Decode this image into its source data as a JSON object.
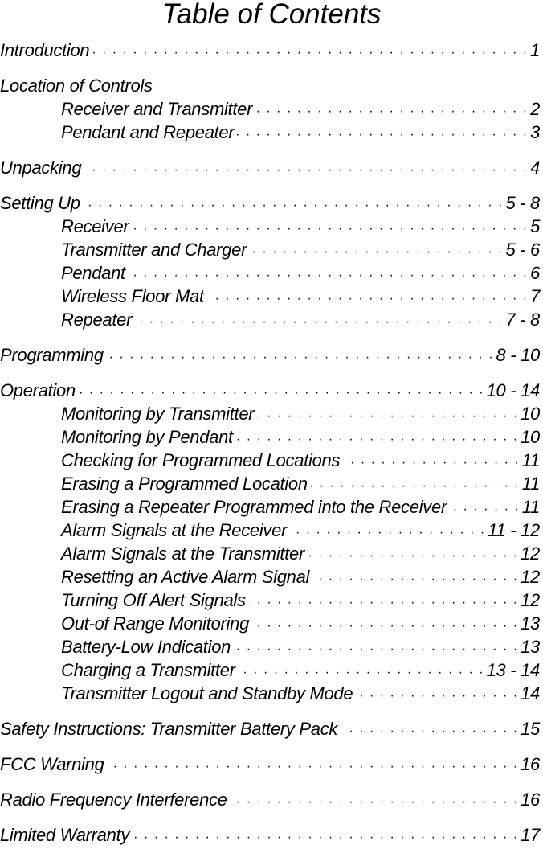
{
  "title": "Table of Contents",
  "entries": [
    {
      "label": "Introduction",
      "page": "1",
      "level": 0,
      "gap": false
    },
    {
      "label": "Location of Controls",
      "page": "",
      "level": 0,
      "gap": true
    },
    {
      "label": "Receiver and Transmitter",
      "page": "2",
      "level": 1,
      "gap": false
    },
    {
      "label": "Pendant and Repeater",
      "page": "3",
      "level": 1,
      "gap": false
    },
    {
      "label": "Unpacking",
      "page": "4",
      "level": 0,
      "gap": true
    },
    {
      "label": "Setting Up",
      "page": "5 - 8",
      "level": 0,
      "gap": true
    },
    {
      "label": "Receiver",
      "page": "5",
      "level": 1,
      "gap": false
    },
    {
      "label": "Transmitter and Charger",
      "page": "5 - 6",
      "level": 1,
      "gap": false
    },
    {
      "label": "Pendant",
      "page": "6",
      "level": 1,
      "gap": false
    },
    {
      "label": "Wireless Floor Mat",
      "page": "7",
      "level": 1,
      "gap": false
    },
    {
      "label": "Repeater",
      "page": "7 - 8",
      "level": 1,
      "gap": false
    },
    {
      "label": "Programming",
      "page": "8 - 10",
      "level": 0,
      "gap": true
    },
    {
      "label": "Operation",
      "page": "10 - 14",
      "level": 0,
      "gap": true
    },
    {
      "label": "Monitoring by Transmitter",
      "page": "10",
      "level": 1,
      "gap": false
    },
    {
      "label": "Monitoring by Pendant",
      "page": "10",
      "level": 1,
      "gap": false
    },
    {
      "label": "Checking for Programmed Locations",
      "page": "11",
      "level": 1,
      "gap": false
    },
    {
      "label": "Erasing a Programmed Location",
      "page": "11",
      "level": 1,
      "gap": false
    },
    {
      "label": "Erasing a Repeater Programmed into the Receiver",
      "page": "11",
      "level": 1,
      "gap": false
    },
    {
      "label": "Alarm Signals at the Receiver",
      "page": "11 - 12",
      "level": 1,
      "gap": false
    },
    {
      "label": "Alarm Signals at the Transmitter",
      "page": "12",
      "level": 1,
      "gap": false
    },
    {
      "label": "Resetting an Active Alarm Signal",
      "page": "12",
      "level": 1,
      "gap": false
    },
    {
      "label": "Turning Off Alert Signals",
      "page": "12",
      "level": 1,
      "gap": false
    },
    {
      "label": "Out-of Range Monitoring",
      "page": "13",
      "level": 1,
      "gap": false
    },
    {
      "label": "Battery-Low Indication",
      "page": "13",
      "level": 1,
      "gap": false
    },
    {
      "label": "Charging a Transmitter",
      "page": "13 - 14",
      "level": 1,
      "gap": false
    },
    {
      "label": "Transmitter Logout and Standby Mode",
      "page": "14",
      "level": 1,
      "gap": false
    },
    {
      "label": "Safety Instructions: Transmitter Battery Pack",
      "page": "15",
      "level": 0,
      "gap": true
    },
    {
      "label": "FCC Warning",
      "page": "16",
      "level": 0,
      "gap": true
    },
    {
      "label": "Radio Frequency Interference",
      "page": "16",
      "level": 0,
      "gap": true
    },
    {
      "label": "Limited Warranty",
      "page": "17",
      "level": 0,
      "gap": true
    }
  ]
}
